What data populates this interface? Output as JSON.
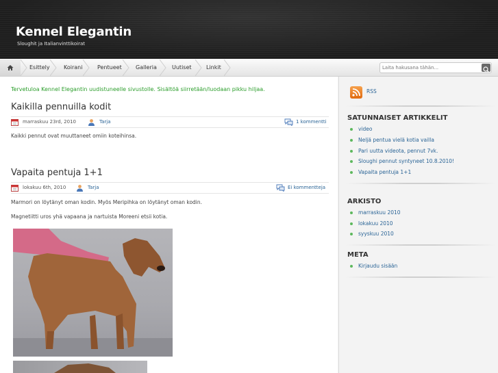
{
  "site": {
    "title": "Kennel Elegantin",
    "description": "Sloughit ja Italianvinttikoirat"
  },
  "nav": {
    "home_icon": "home-icon",
    "items": [
      {
        "label": "Esittely"
      },
      {
        "label": "Koirani"
      },
      {
        "label": "Pentueet"
      },
      {
        "label": "Galleria"
      },
      {
        "label": "Uutiset"
      },
      {
        "label": "Linkit"
      }
    ],
    "search_placeholder": "Laita hakusana tähän..."
  },
  "main": {
    "welcome": "Tervetuloa Kennel Elegantin uudistuneelle sivustolle. Sisältöä siirretään/luodaan pikku hiljaa.",
    "posts": [
      {
        "title": "Kaikilla pennuilla kodit",
        "date": "marraskuu 23rd, 2010",
        "author": "Tarja",
        "comments": "1 kommentti",
        "paragraphs": [
          "Kaikki pennut ovat muuttaneet omiin koteihinsa."
        ]
      },
      {
        "title": "Vapaita pentuja 1+1",
        "date": "lokakuu 6th, 2010",
        "author": "Tarja",
        "comments": "Ei kommentteja",
        "paragraphs": [
          "Marmori on löytänyt oman kodin. Myös Meripihka on löytänyt oman kodin.",
          "Magnetiitti uros yhä vapaana ja nartuista Moreeni etsii kotia."
        ]
      }
    ]
  },
  "sidebar": {
    "rss_label": "RSS",
    "random_title": "SATUNNAISET ARTIKKELIT",
    "random_items": [
      {
        "label": "video"
      },
      {
        "label": "Neljä pentua vielä kotia vailla"
      },
      {
        "label": "Pari uutta videota, pennut 7vk."
      },
      {
        "label": "Sloughi pennut syntyneet 10.8.2010!"
      },
      {
        "label": "Vapaita pentuja 1+1"
      }
    ],
    "archive_title": "ARKISTO",
    "archive_items": [
      {
        "label": "marraskuu 2010"
      },
      {
        "label": "lokakuu 2010"
      },
      {
        "label": "syyskuu 2010"
      }
    ],
    "meta_title": "META",
    "meta_items": [
      {
        "label": "Kirjaudu sisään"
      }
    ]
  },
  "colors": {
    "header_bg": "#1f1f1f",
    "link": "#2a6496",
    "welcome_green": "#2a9d2a",
    "bullet_green": "#5db85d",
    "rss_orange": "#e97a1e"
  }
}
